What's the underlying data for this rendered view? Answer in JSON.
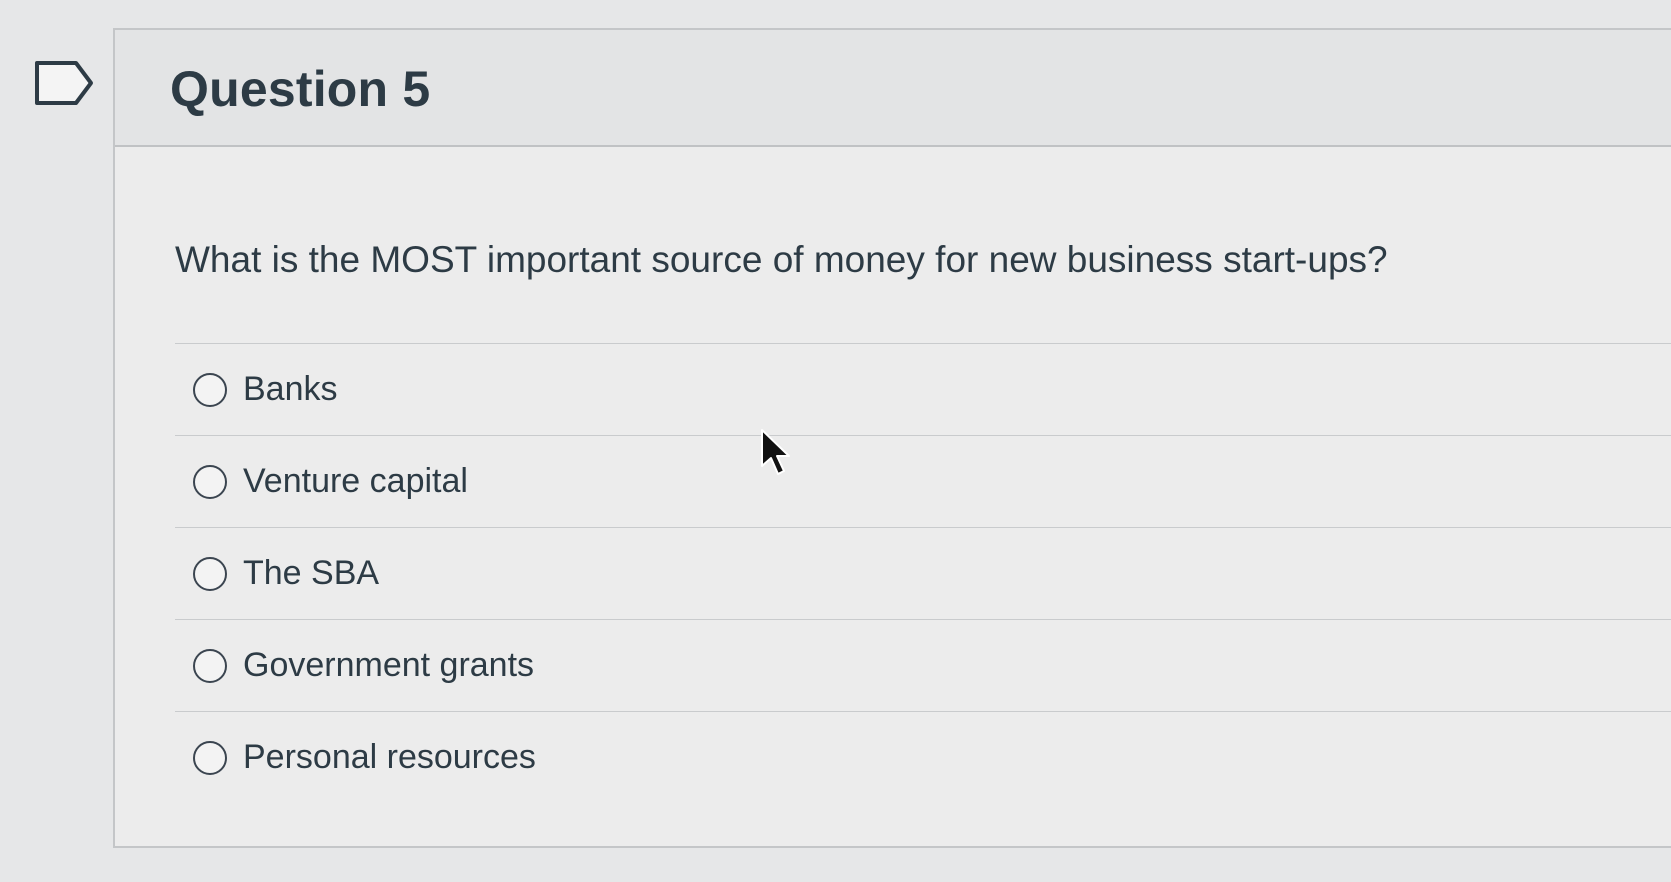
{
  "question": {
    "title": "Question 5",
    "text": "What is the MOST important source of money for new business start-ups?"
  },
  "answers": [
    {
      "label": "Banks",
      "selected": false
    },
    {
      "label": "Venture capital",
      "selected": false
    },
    {
      "label": "The SBA",
      "selected": false
    },
    {
      "label": "Government grants",
      "selected": false
    },
    {
      "label": "Personal resources",
      "selected": false
    }
  ],
  "icons": {
    "flag": "flag-question-icon",
    "radio": "radio-button-icon",
    "cursor": "mouse-pointer-icon"
  },
  "colors": {
    "text": "#2d3b45",
    "background": "#e6e7e8",
    "card": "#ececec",
    "header": "#e3e4e5"
  }
}
